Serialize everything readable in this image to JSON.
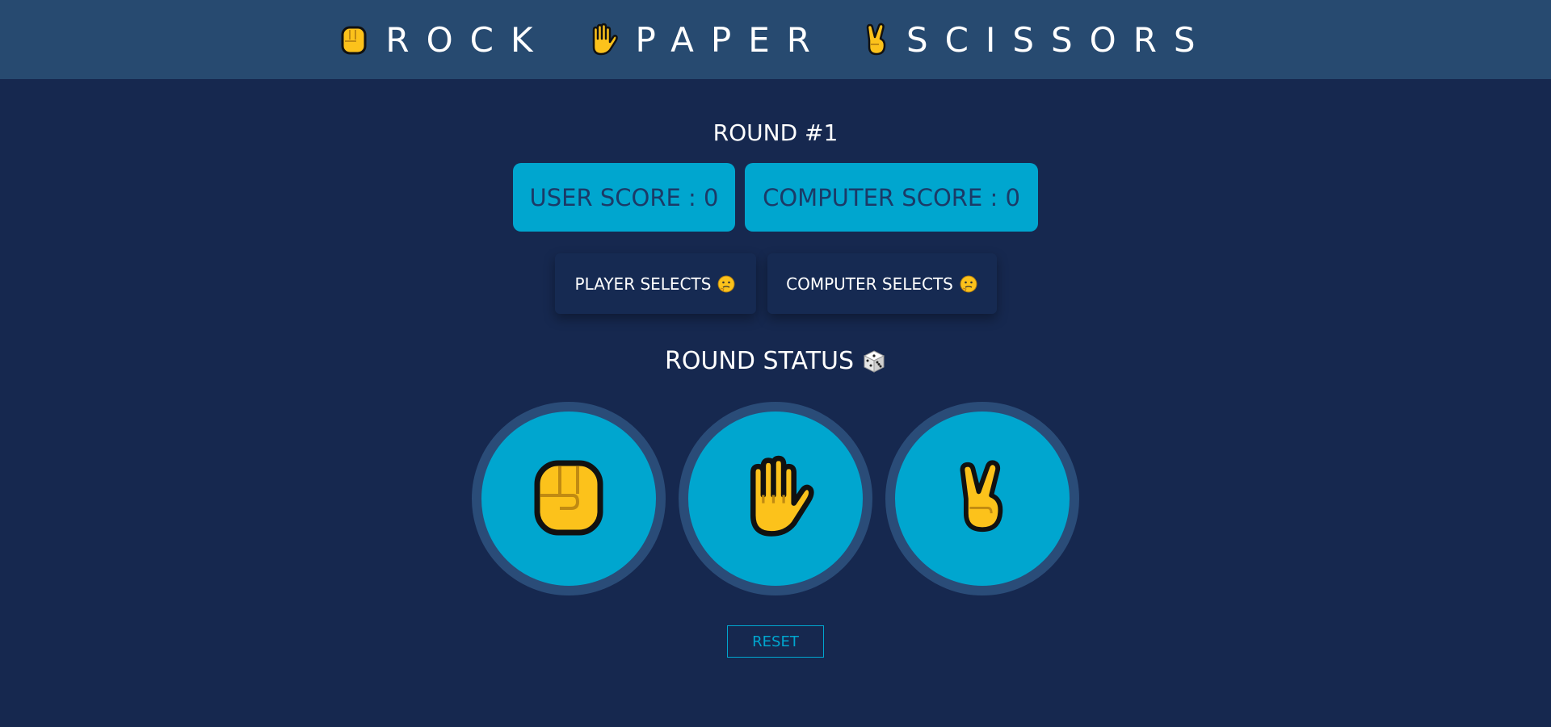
{
  "header": {
    "words": [
      {
        "icon": "raised-fist-icon",
        "label": "ROCK"
      },
      {
        "icon": "raised-hand-icon",
        "label": "PAPER"
      },
      {
        "icon": "victory-hand-icon",
        "label": "SCISSORS"
      }
    ]
  },
  "round": {
    "label": "ROUND #1"
  },
  "scores": {
    "user": "USER SCORE : 0",
    "computer": "COMPUTER SCORE : 0"
  },
  "selections": {
    "player": "PLAYER SELECTS",
    "computer": "COMPUTER SELECTS",
    "icon": "thinking-face-icon"
  },
  "status": {
    "label": "ROUND STATUS",
    "icon": "dice-icon"
  },
  "choices": [
    {
      "name": "rock",
      "icon": "raised-fist-icon"
    },
    {
      "name": "paper",
      "icon": "raised-hand-icon"
    },
    {
      "name": "scissors",
      "icon": "victory-hand-icon"
    }
  ],
  "reset": {
    "label": "RESET"
  },
  "colors": {
    "background": "#16284f",
    "header": "#274a70",
    "accent": "#00a6cf",
    "score_text": "#1b3a67"
  }
}
